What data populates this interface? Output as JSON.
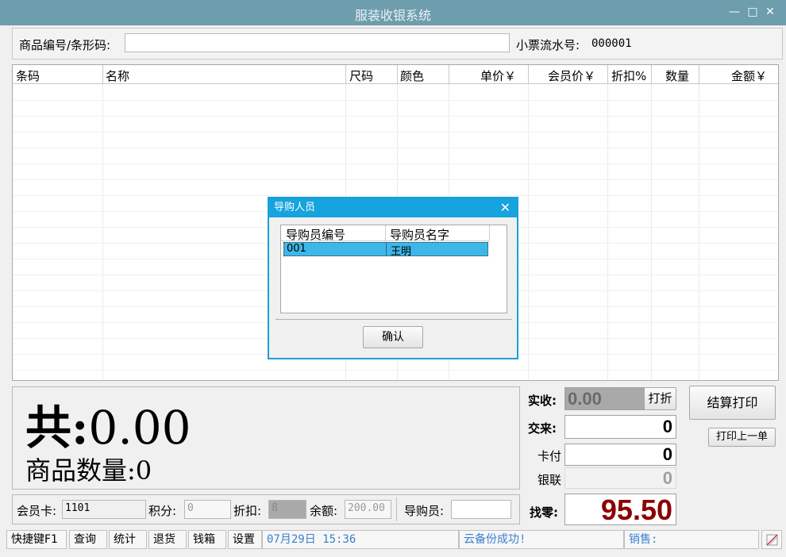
{
  "window": {
    "title": "服装收银系统",
    "min_icon": "minimize-icon",
    "max_icon": "maximize-icon",
    "close_icon": "close-icon"
  },
  "topbar": {
    "barcode_label": "商品编号/条形码:",
    "barcode_value": "",
    "receipt_label": "小票流水号:",
    "receipt_no": "000001"
  },
  "grid": {
    "columns": [
      "条码",
      "名称",
      "尺码",
      "颜色",
      "单价￥",
      "会员价￥",
      "折扣%",
      "数量",
      "金额￥"
    ],
    "rows": []
  },
  "totals": {
    "total_prefix": "共:",
    "total_value": "0.00",
    "qty_label": "商品数量:",
    "qty_value": "0"
  },
  "payment": {
    "received_label": "实收:",
    "received_value": "0.00",
    "discount_btn": "打折",
    "paid_label": "交来:",
    "paid_value": "0",
    "card_label": "卡付",
    "card_value": "0",
    "unionpay_label": "银联",
    "unionpay_value": "0",
    "change_label": "找零:",
    "change_value": "95.50",
    "change_color": "#8b0000",
    "checkout_btn": "结算打印",
    "reprint_btn": "打印上一单"
  },
  "member": {
    "card_label": "会员卡:",
    "card_value": "1101",
    "points_label": "积分:",
    "points_value": "0",
    "discount_label": "折扣:",
    "discount_value": "8",
    "balance_label": "余额:",
    "balance_value": "200.00",
    "guide_label": "导购员:",
    "guide_value": ""
  },
  "statusbar": {
    "shortcuts": "快捷键F1",
    "query": "查询",
    "stats": "统计",
    "returns": "退货",
    "cashbox": "钱箱",
    "settings": "设置",
    "datetime": "07月29日 15:36",
    "backup": "云备份成功!",
    "sales_label": "销售:",
    "corner_icon": "resize-grip-icon"
  },
  "dialog": {
    "title": "导购人员",
    "columns": [
      "导购员编号",
      "导购员名字"
    ],
    "rows": [
      {
        "id": "001",
        "name": "王明"
      }
    ],
    "confirm_btn": "确认"
  }
}
